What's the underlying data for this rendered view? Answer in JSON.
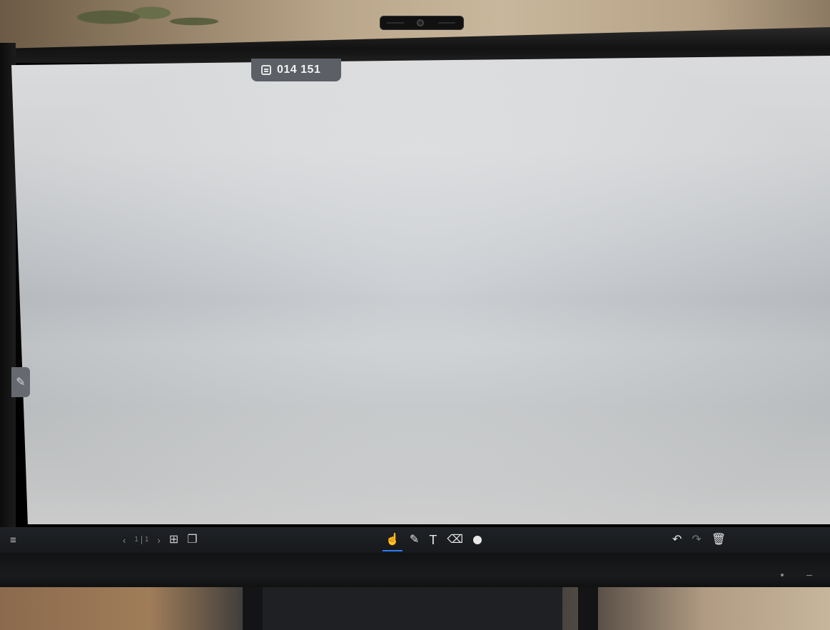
{
  "whiteboard": {
    "room_code": "014 151",
    "room_code_icon": "screen-share-icon"
  },
  "side_handle": {
    "icon": "pencil-icon",
    "glyph": "✎"
  },
  "toolbar": {
    "menu": {
      "icon": "hamburger-menu-icon",
      "glyph": "≡"
    },
    "navigation": {
      "prev_glyph": "‹",
      "next_glyph": "›",
      "current_page": "1",
      "total_pages": "1",
      "add_page_glyph": "⊞",
      "copy_page_glyph": "❐"
    },
    "tools": {
      "pointer_glyph": "☝",
      "pen_glyph": "✎",
      "text_glyph": "T",
      "eraser_glyph": "⌫",
      "more_glyph": "+"
    },
    "history": {
      "undo_glyph": "↶",
      "redo_glyph": "↷",
      "delete_glyph": "🗑"
    },
    "accent_color": "#2e7cf6"
  }
}
